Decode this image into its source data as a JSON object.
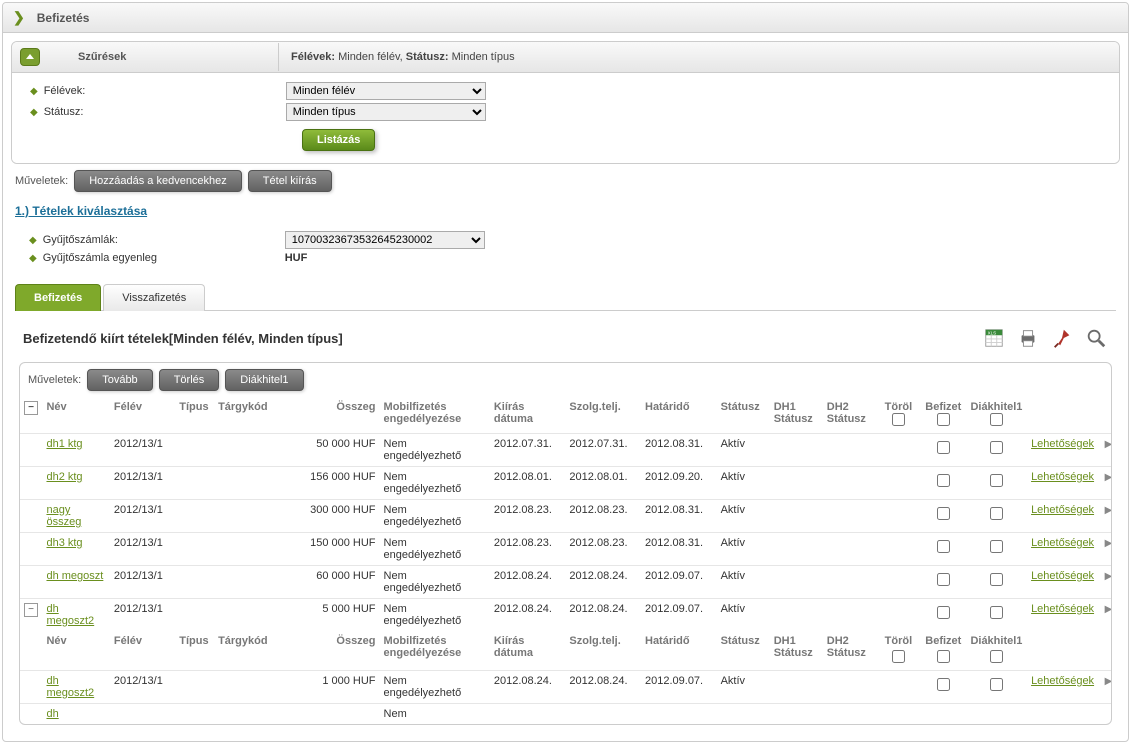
{
  "page": {
    "title": "Befizetés"
  },
  "filter": {
    "title": "Szűrések",
    "summary_html": "<b>Félévek:</b> Minden félév, <b>Státusz:</b> Minden típus",
    "terms": {
      "label": "Félévek:",
      "selected": "Minden félév"
    },
    "status": {
      "label": "Státusz:",
      "selected": "Minden típus"
    },
    "list_button": "Listázás"
  },
  "ops": {
    "label": "Műveletek:",
    "add_fav": "Hozzáadás a kedvencekhez",
    "new_item": "Tétel kiírás"
  },
  "section1": {
    "title": "1.) Tételek kiválasztása"
  },
  "accounts": {
    "label": "Gyűjtőszámlák:",
    "selected": "10700323673532645230002",
    "balance_label": "Gyűjtőszámla egyenleg",
    "balance_value": "HUF"
  },
  "tabs": {
    "pay": "Befizetés",
    "refund": "Visszafizetés"
  },
  "grid": {
    "title": "Befizetendő kiírt tételek[Minden félév, Minden típus]",
    "ops_label": "Műveletek:",
    "btn_next": "Tovább",
    "btn_del": "Törlés",
    "btn_dh1": "Diákhitel1",
    "headers": {
      "name": "Név",
      "term": "Félév",
      "type": "Típus",
      "subj": "Tárgykód",
      "amount": "Összeg",
      "mobile": "Mobilfizetés engedélyezése",
      "issue": "Kiírás dátuma",
      "serv": "Szolg.telj.",
      "due": "Határidő",
      "status": "Státusz",
      "dh1": "DH1 Státusz",
      "dh2": "DH2 Státusz",
      "del": "Töröl",
      "pay": "Befizet",
      "dhcol": "Diákhitel1",
      "opt": "Lehetőségek"
    },
    "rows": [
      {
        "name": "dh1 ktg",
        "term": "2012/13/1",
        "amount": "50 000 HUF",
        "mobile": "Nem engedélyezhető",
        "issue": "2012.07.31.",
        "serv": "2012.07.31.",
        "due": "2012.08.31.",
        "status": "Aktív",
        "expand": false
      },
      {
        "name": "dh2 ktg",
        "term": "2012/13/1",
        "amount": "156 000 HUF",
        "mobile": "Nem engedélyezhető",
        "issue": "2012.08.01.",
        "serv": "2012.08.01.",
        "due": "2012.09.20.",
        "status": "Aktív",
        "expand": false
      },
      {
        "name": "nagy összeg",
        "term": "2012/13/1",
        "amount": "300 000 HUF",
        "mobile": "Nem engedélyezhető",
        "issue": "2012.08.23.",
        "serv": "2012.08.23.",
        "due": "2012.08.31.",
        "status": "Aktív",
        "expand": false
      },
      {
        "name": "dh3 ktg",
        "term": "2012/13/1",
        "amount": "150 000 HUF",
        "mobile": "Nem engedélyezhető",
        "issue": "2012.08.23.",
        "serv": "2012.08.23.",
        "due": "2012.08.31.",
        "status": "Aktív",
        "expand": false
      },
      {
        "name": "dh megoszt",
        "term": "2012/13/1",
        "amount": "60 000 HUF",
        "mobile": "Nem engedélyezhető",
        "issue": "2012.08.24.",
        "serv": "2012.08.24.",
        "due": "2012.09.07.",
        "status": "Aktív",
        "expand": false
      },
      {
        "name": "dh megoszt2",
        "term": "2012/13/1",
        "amount": "5 000 HUF",
        "mobile": "Nem engedélyezhető",
        "issue": "2012.08.24.",
        "serv": "2012.08.24.",
        "due": "2012.09.07.",
        "status": "Aktív",
        "expand": true
      }
    ],
    "subrow": {
      "name": "dh megoszt2",
      "term": "2012/13/1",
      "amount": "1 000 HUF",
      "mobile": "Nem engedélyezhető",
      "issue": "2012.08.24.",
      "serv": "2012.08.24.",
      "due": "2012.09.07.",
      "status": "Aktív"
    },
    "subrow2_name": "dh",
    "subrow2_mobile": "Nem"
  }
}
